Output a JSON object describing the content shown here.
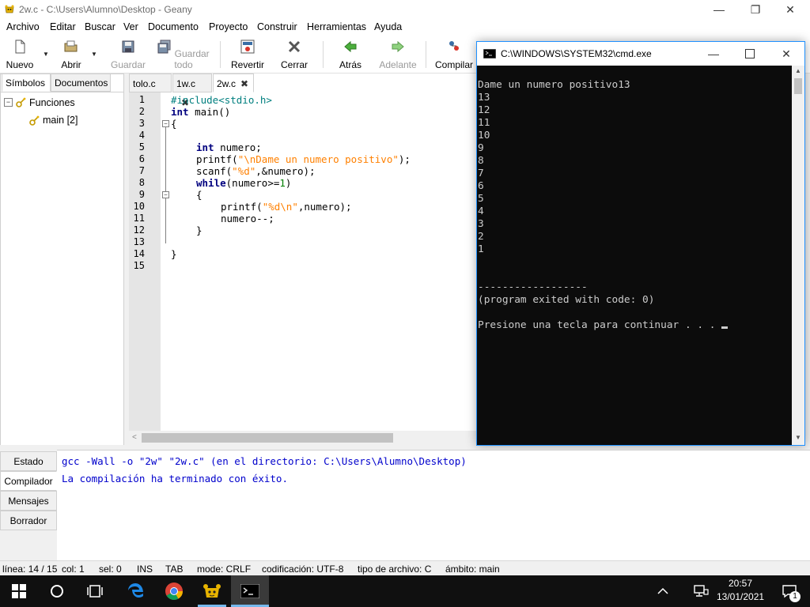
{
  "window": {
    "title": "2w.c - C:\\Users\\Alumno\\Desktop - Geany",
    "minimize": "—",
    "restore": "❐",
    "close": "✕"
  },
  "menubar": [
    "Archivo",
    "Editar",
    "Buscar",
    "Ver",
    "Documento",
    "Proyecto",
    "Construir",
    "Herramientas",
    "Ayuda"
  ],
  "toolbar": {
    "nuevo": "Nuevo",
    "abrir": "Abrir",
    "guardar": "Guardar",
    "guardar_todo": "Guardar todo",
    "revertir": "Revertir",
    "cerrar": "Cerrar",
    "atras": "Atrás",
    "adelante": "Adelante",
    "compilar": "Compilar"
  },
  "sidebar": {
    "tabs": [
      "Símbolos",
      "Documentos"
    ],
    "tree": {
      "group": "Funciones",
      "item": "main [2]"
    }
  },
  "editor": {
    "tabs": [
      "tolo.c",
      "1w.c",
      "2w.c"
    ],
    "line_numbers": [
      "1",
      "2",
      "3",
      "4",
      "5",
      "6",
      "7",
      "8",
      "9",
      "10",
      "11",
      "12",
      "13",
      "14",
      "15"
    ]
  },
  "code": {
    "l1": "#include<stdio.h>",
    "l2_kw": "int",
    "l2_rest": " main()",
    "l3": "{",
    "l5_kw": "int",
    "l5_rest": " numero;",
    "l6_a": "printf(",
    "l6_str": "\"\\nDame un numero positivo\"",
    "l6_b": ");",
    "l7_a": "scanf(",
    "l7_str": "\"%d\"",
    "l7_b": ",&numero);",
    "l8_kw": "while",
    "l8_a": "(numero>=",
    "l8_num": "1",
    "l8_b": ")",
    "l9": "{",
    "l10_a": "printf(",
    "l10_str": "\"%d\\n\"",
    "l10_b": ",numero);",
    "l11": "numero--;",
    "l12": "}",
    "l14": "}"
  },
  "cmd": {
    "title": "C:\\WINDOWS\\SYSTEM32\\cmd.exe",
    "lines": [
      "Dame un numero positivo13",
      "13",
      "12",
      "11",
      "10",
      "9",
      "8",
      "7",
      "6",
      "5",
      "4",
      "3",
      "2",
      "1",
      "",
      "",
      "------------------",
      "(program exited with code: 0)",
      "",
      "Presione una tecla para continuar . . . "
    ]
  },
  "messages": {
    "tabs": [
      "Estado",
      "Compilador",
      "Mensajes",
      "Borrador"
    ],
    "lines": [
      "gcc -Wall -o \"2w\" \"2w.c\" (en el directorio: C:\\Users\\Alumno\\Desktop)",
      "La compilación ha terminado con éxito."
    ]
  },
  "statusbar": {
    "line": "línea: 14 / 15",
    "col": "col: 1",
    "sel": "sel: 0",
    "ins": "INS",
    "tab": "TAB",
    "mode": "mode: CRLF",
    "encoding": "codificación: UTF-8",
    "filetype": "tipo de archivo: C",
    "scope": "ámbito: main"
  },
  "taskbar": {
    "time": "20:57",
    "date": "13/01/2021",
    "notif_count": "1"
  }
}
